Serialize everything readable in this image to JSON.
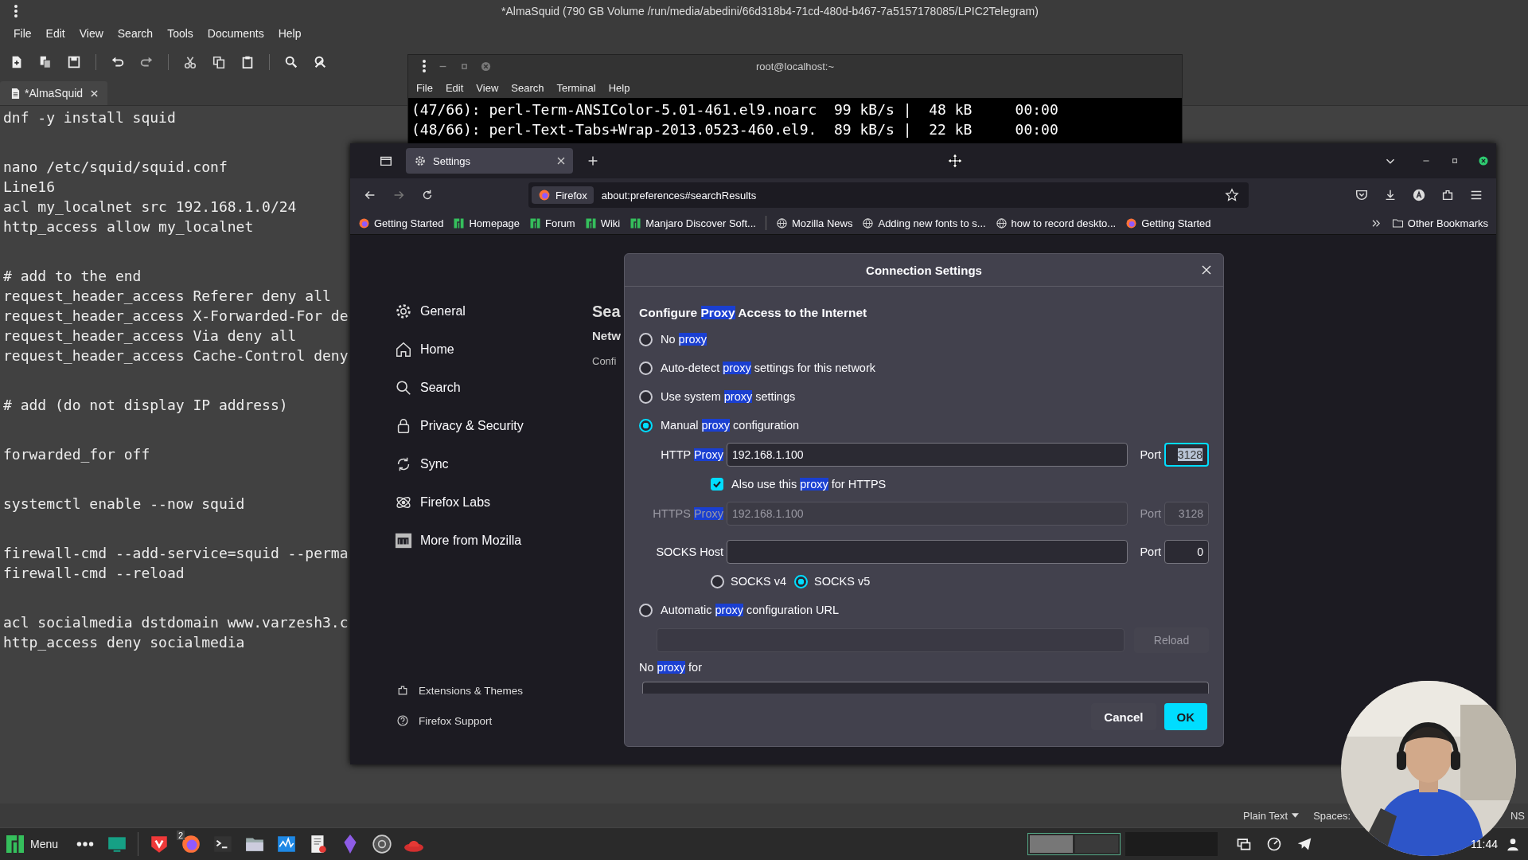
{
  "editor": {
    "title": "*AlmaSquid (790 GB Volume /run/media/abedini/66d318b4-71cd-480d-b467-7a5157178085/LPIC2Telegram)",
    "menu": [
      "File",
      "Edit",
      "View",
      "Search",
      "Tools",
      "Documents",
      "Help"
    ],
    "tabs": [
      {
        "label": "*AlmaSquid",
        "selected": true
      }
    ],
    "blocks": [
      [
        "dnf -y install squid"
      ],
      [
        "nano /etc/squid/squid.conf",
        "Line16",
        "acl my_localnet src 192.168.1.0/24",
        "http_access allow my_localnet"
      ],
      [
        "# add to the end",
        "request_header_access Referer deny all",
        "request_header_access X-Forwarded-For de",
        "request_header_access Via deny all",
        "request_header_access Cache-Control deny"
      ],
      [
        "# add (do not display IP address)"
      ],
      [
        "forwarded_for off"
      ],
      [
        "systemctl enable --now squid"
      ],
      [
        "firewall-cmd --add-service=squid --perma",
        "firewall-cmd --reload"
      ],
      [
        "acl socialmedia dstdomain www.varzesh3.c",
        "http_access deny socialmedia"
      ]
    ],
    "status": {
      "syntax": "Plain Text",
      "spaces": "Spaces:",
      "extra": "NS"
    }
  },
  "terminal": {
    "title": "root@localhost:~",
    "menu": [
      "File",
      "Edit",
      "View",
      "Search",
      "Terminal",
      "Help"
    ],
    "lines": [
      "(47/66): perl-Term-ANSIColor-5.01-461.el9.noarc  99 kB/s |  48 kB     00:00",
      "(48/66): perl-Text-Tabs+Wrap-2013.0523-460.el9.  89 kB/s |  22 kB     00:00"
    ]
  },
  "browser": {
    "tabs": [
      {
        "label": "Settings",
        "selected": true
      }
    ],
    "identity": "Firefox",
    "url": "about:preferences#searchResults",
    "bookmarks": [
      {
        "label": "Getting Started"
      },
      {
        "label": "Homepage"
      },
      {
        "label": "Forum"
      },
      {
        "label": "Wiki"
      },
      {
        "label": "Manjaro Discover Soft..."
      },
      {
        "label": "Mozilla News"
      },
      {
        "label": "Adding new fonts to s..."
      },
      {
        "label": "how to record deskto..."
      },
      {
        "label": "Getting Started"
      }
    ],
    "other_bookmarks": "Other Bookmarks",
    "sidebar": {
      "items": [
        {
          "label": "General",
          "selected": false
        },
        {
          "label": "Home",
          "selected": false
        },
        {
          "label": "Search",
          "selected": false
        },
        {
          "label": "Privacy & Security",
          "selected": false
        },
        {
          "label": "Sync",
          "selected": false
        },
        {
          "label": "Firefox Labs",
          "selected": false
        },
        {
          "label": "More from Mozilla",
          "selected": false
        }
      ],
      "footer": [
        "Extensions & Themes",
        "Firefox Support"
      ]
    },
    "page": {
      "heading": "Sea",
      "subheading": "Netw",
      "text": "Confi"
    }
  },
  "dialog": {
    "title": "Connection Settings",
    "heading": [
      {
        "text": "Configure ",
        "highlight": false
      },
      {
        "text": "Proxy",
        "highlight": true
      },
      {
        "text": " Access to the Internet",
        "highlight": false
      }
    ],
    "options": [
      {
        "selected": false,
        "label": [
          {
            "text": "No ",
            "highlight": false
          },
          {
            "text": "proxy",
            "highlight": true
          }
        ]
      },
      {
        "selected": false,
        "label": [
          {
            "text": "Auto-detect ",
            "highlight": false
          },
          {
            "text": "proxy",
            "highlight": true
          },
          {
            "text": " settings for this network",
            "highlight": false
          }
        ]
      },
      {
        "selected": false,
        "label": [
          {
            "text": "Use system ",
            "highlight": false
          },
          {
            "text": "proxy",
            "highlight": true
          },
          {
            "text": " settings",
            "highlight": false
          }
        ]
      },
      {
        "selected": true,
        "label": [
          {
            "text": "Manual ",
            "highlight": false
          },
          {
            "text": "proxy",
            "highlight": true
          },
          {
            "text": " configuration",
            "highlight": false
          }
        ]
      },
      {
        "selected": false,
        "label": [
          {
            "text": "Automatic ",
            "highlight": false
          },
          {
            "text": "proxy",
            "highlight": true
          },
          {
            "text": " configuration URL",
            "highlight": false
          }
        ]
      }
    ],
    "http": {
      "label": [
        {
          "text": "HTTP ",
          "highlight": false
        },
        {
          "text": "Proxy",
          "highlight": true
        }
      ],
      "value": "192.168.1.100",
      "port_label": "Port",
      "port": "3128",
      "port_focused": true
    },
    "also_https": {
      "checked": true,
      "label": [
        {
          "text": "Also use this ",
          "highlight": false
        },
        {
          "text": "proxy",
          "highlight": true
        },
        {
          "text": " for HTTPS",
          "highlight": false
        }
      ]
    },
    "https": {
      "disabled": true,
      "label": [
        {
          "text": "HTTPS ",
          "highlight": false
        },
        {
          "text": "Proxy",
          "highlight": true
        }
      ],
      "value": "192.168.1.100",
      "port_label": "Port",
      "port": "3128"
    },
    "socks": {
      "label": "SOCKS Host",
      "port_label": "Port",
      "port": "0",
      "versions": [
        {
          "label": "SOCKS v4",
          "selected": false
        },
        {
          "label": "SOCKS v5",
          "selected": true
        }
      ]
    },
    "reload": {
      "label": "Reload",
      "disabled": true
    },
    "no_proxy": {
      "label": [
        {
          "text": "No ",
          "highlight": false
        },
        {
          "text": "proxy",
          "highlight": true
        },
        {
          "text": " for",
          "highlight": false
        }
      ]
    },
    "buttons": [
      {
        "label": "Cancel",
        "primary": false
      },
      {
        "label": "OK",
        "primary": true
      }
    ]
  },
  "taskbar": {
    "menu": "Menu",
    "badge": "2",
    "clock": "11:44"
  }
}
